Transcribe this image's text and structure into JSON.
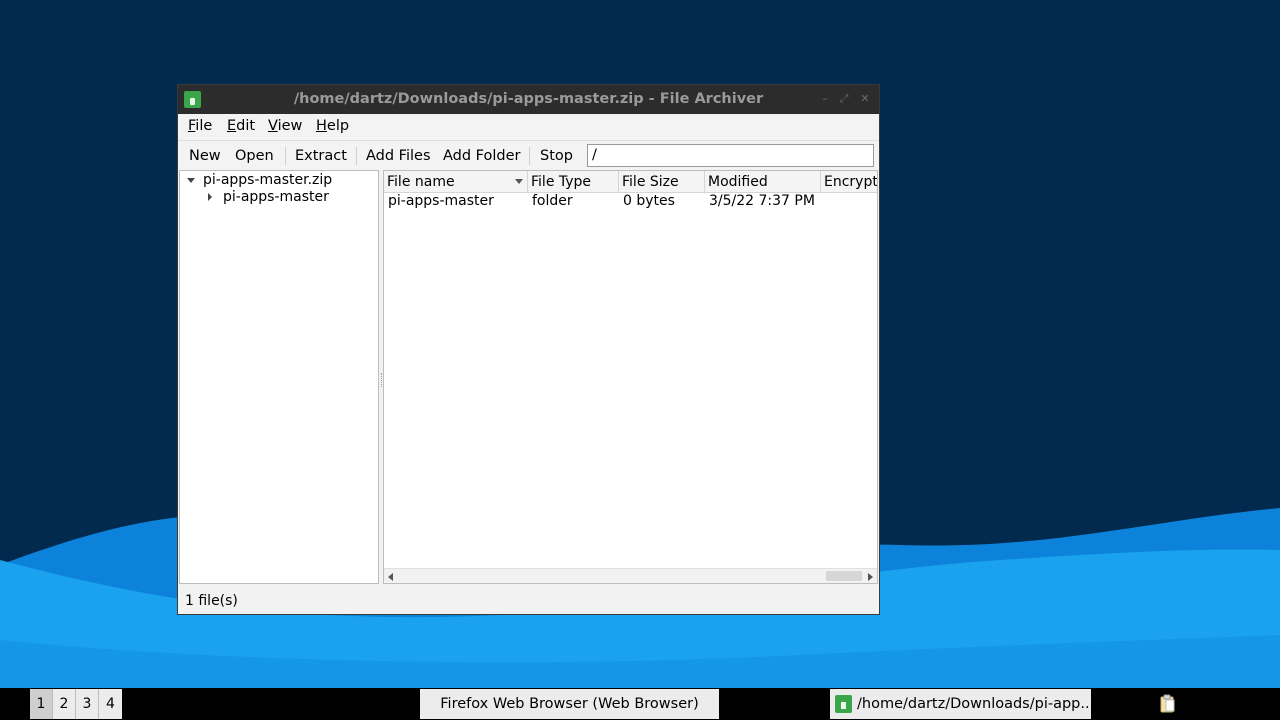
{
  "window": {
    "title": "/home/dartz/Downloads/pi-apps-master.zip - File Archiver",
    "minimize": "–",
    "maximize": "⤢",
    "close": "✕"
  },
  "menubar": {
    "items": [
      {
        "label_u": "F",
        "label_rest": "ile"
      },
      {
        "label_u": "E",
        "label_rest": "dit"
      },
      {
        "label_u": "V",
        "label_rest": "iew"
      },
      {
        "label_u": "H",
        "label_rest": "elp"
      }
    ]
  },
  "toolbar": {
    "new": "New",
    "open": "Open",
    "extract": "Extract",
    "add_files": "Add Files",
    "add_folder": "Add Folder",
    "stop": "Stop",
    "location": "/"
  },
  "tree": {
    "root": "pi-apps-master.zip",
    "child": "pi-apps-master"
  },
  "table": {
    "columns": [
      "File name",
      "File Type",
      "File Size",
      "Modified",
      "Encrypte"
    ],
    "rows": [
      [
        "pi-apps-master",
        "folder",
        "0 bytes",
        "3/5/22 7:37 PM",
        ""
      ]
    ]
  },
  "status": {
    "text": "1 file(s)"
  },
  "taskbar": {
    "workspaces": [
      "1",
      "2",
      "3",
      "4"
    ],
    "tasks": [
      {
        "label": "Firefox Web Browser (Web Browser)"
      },
      {
        "label": "/home/dartz/Downloads/pi-app..."
      }
    ]
  },
  "colors": {
    "desktop_dark": "#022a4e",
    "wave_light": "#19a5ef",
    "wave_mid": "#0b7ed8",
    "titlebar": "#2c2c2c",
    "app_icon_green": "#3aa64a"
  }
}
